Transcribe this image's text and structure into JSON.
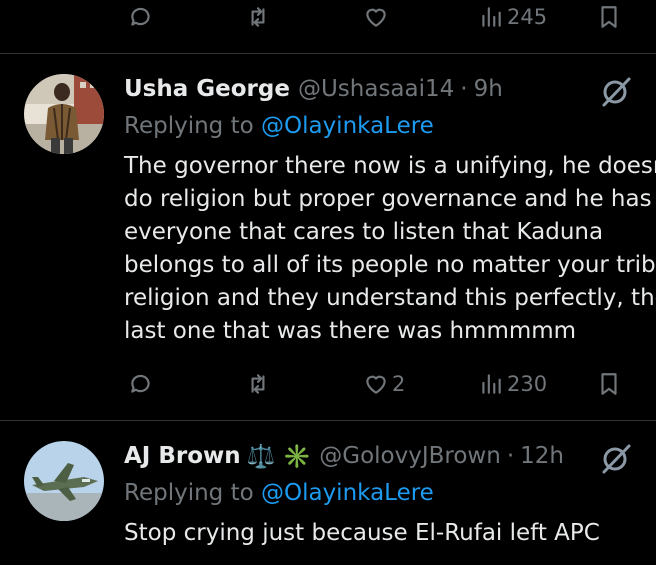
{
  "top_actions": {
    "reply_count": "",
    "retweet_count": "",
    "like_count": "",
    "views": "245"
  },
  "tweets": [
    {
      "name": "Usha George",
      "badges": "",
      "handle": "@Ushasaai14",
      "separator": "·",
      "time": "9h",
      "replying_prefix": "Replying to",
      "replying_handle": "@OlayinkaLere",
      "lines": [
        "The governor there now is a unifying, he doesn",
        "do religion but proper governance and he has t",
        "everyone that cares to listen that Kaduna",
        "belongs to all of its people no matter your tribe",
        "religion and they understand this perfectly, the",
        "last one that was there was hmmmmm"
      ],
      "actions": {
        "reply_count": "",
        "retweet_count": "",
        "like_count": "2",
        "views": "230"
      }
    },
    {
      "name": "AJ Brown",
      "badges": "⚖️ ✳️",
      "handle": "@GolovyJBrown",
      "separator": "·",
      "time": "12h",
      "replying_prefix": "Replying to",
      "replying_handle": "@OlayinkaLere",
      "lines": [
        "Stop crying just because El-Rufai left APC"
      ]
    }
  ],
  "colors": {
    "background": "#000000",
    "text": "#e7e9ea",
    "muted": "#71767b",
    "link": "#1d9bf0",
    "divider": "#2f3336"
  }
}
